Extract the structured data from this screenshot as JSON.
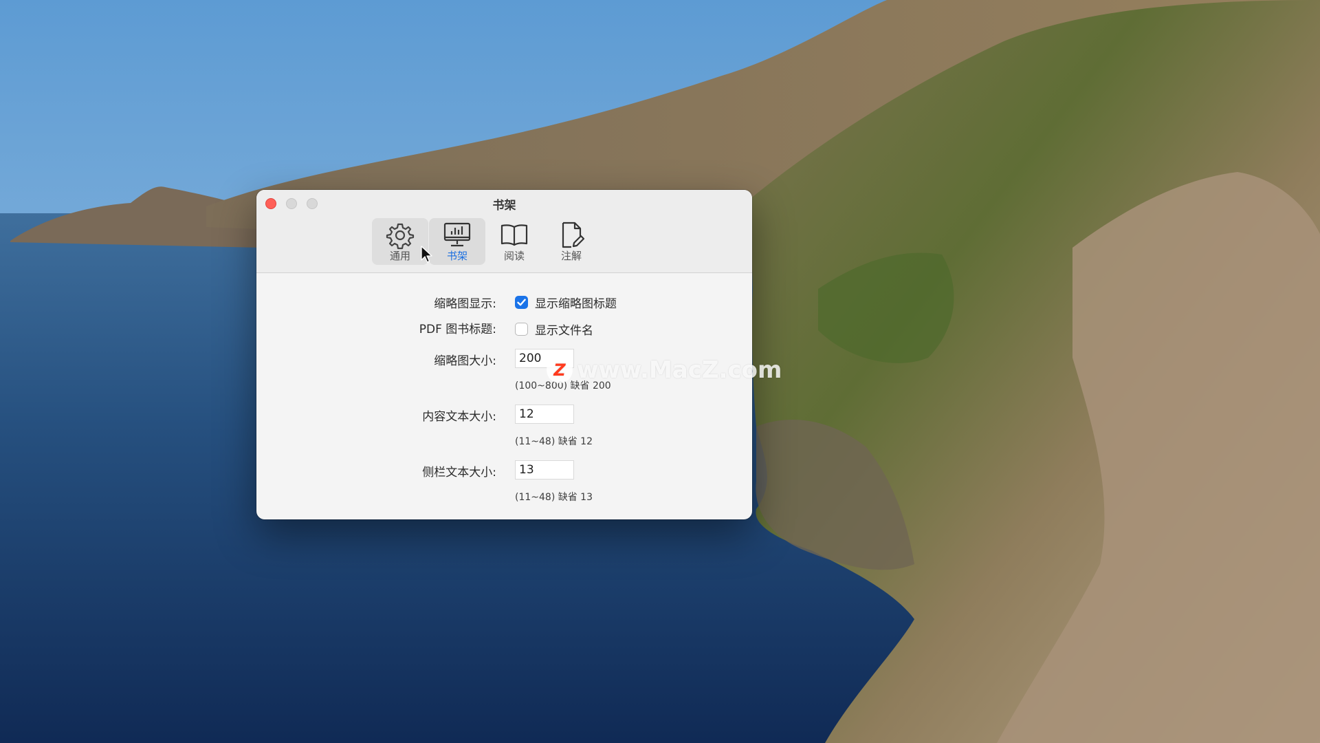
{
  "window": {
    "title": "书架",
    "tabs": [
      {
        "id": "general",
        "label": "通用",
        "icon": "gear-icon"
      },
      {
        "id": "bookshelf",
        "label": "书架",
        "icon": "monitor-chart-icon",
        "selected": true
      },
      {
        "id": "reading",
        "label": "阅读",
        "icon": "book-icon"
      },
      {
        "id": "annotation",
        "label": "注解",
        "icon": "note-pen-icon"
      }
    ]
  },
  "settings": {
    "thumb_display": {
      "label": "缩略图显示:",
      "checkbox_label": "显示缩略图标题",
      "checked": true
    },
    "pdf_title": {
      "label": "PDF 图书标题:",
      "checkbox_label": "显示文件名",
      "checked": false
    },
    "thumb_size": {
      "label": "缩略图大小:",
      "value": "200",
      "hint": "(100~800) 缺省 200"
    },
    "content_text_size": {
      "label": "内容文本大小:",
      "value": "12",
      "hint": "(11~48) 缺省 12"
    },
    "sidebar_text_size": {
      "label": "侧栏文本大小:",
      "value": "13",
      "hint": "(11~48) 缺省 13"
    }
  },
  "watermark": {
    "logo": "Z",
    "text": "www.MacZ.com"
  },
  "colors": {
    "accent": "#1a73e8",
    "close_button": "#fe5f57",
    "window_bg": "#f4f4f4"
  }
}
